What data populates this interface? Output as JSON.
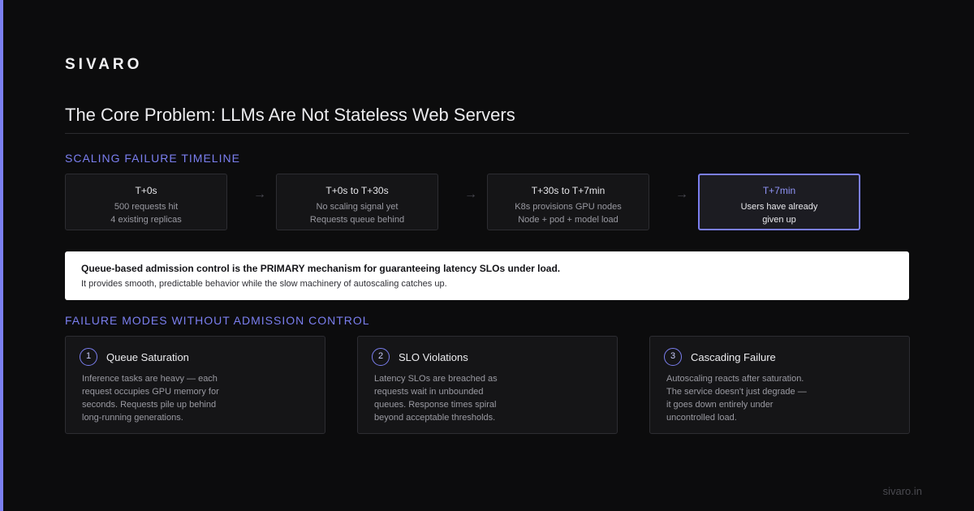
{
  "brand": {
    "logo": "SIVARO",
    "url": "sivaro.in"
  },
  "page": {
    "title": "The Core Problem: LLMs Are Not Stateless Web Servers"
  },
  "timeline": {
    "label": "SCALING FAILURE TIMELINE",
    "arrow_glyph": "→",
    "steps": [
      {
        "time": "T+0s",
        "line1": "500 requests hit",
        "line2": "4 existing replicas"
      },
      {
        "time": "T+0s to T+30s",
        "line1": "No scaling signal yet",
        "line2": "Requests queue behind"
      },
      {
        "time": "T+30s to T+7min",
        "line1": "K8s provisions GPU nodes",
        "line2": "Node + pod + model load"
      },
      {
        "time": "T+7min",
        "line1": "Users have already",
        "line2": "given up"
      }
    ]
  },
  "callout": {
    "heading": "Queue-based admission control is the PRIMARY mechanism for guaranteeing latency SLOs under load.",
    "subtext": "It provides smooth, predictable behavior while the slow machinery of autoscaling catches up."
  },
  "failure_modes": {
    "label": "FAILURE MODES WITHOUT ADMISSION CONTROL",
    "items": [
      {
        "number": "1",
        "title": "Queue Saturation",
        "description": "Inference tasks are heavy — each request occupies GPU memory for seconds. Requests pile up behind long-running generations."
      },
      {
        "number": "2",
        "title": "SLO Violations",
        "description": "Latency SLOs are breached as requests wait in unbounded queues. Response times spiral beyond acceptable thresholds."
      },
      {
        "number": "3",
        "title": "Cascading Failure",
        "description": "Autoscaling reacts after saturation. The service doesn't just degrade — it goes down entirely under uncontrolled load."
      }
    ]
  },
  "colors": {
    "accent": "#7b7ff0",
    "background": "#0c0c0d",
    "card": "#151517",
    "callout_bg": "#ffffff"
  }
}
